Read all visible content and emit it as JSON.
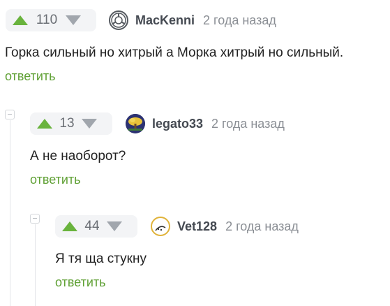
{
  "comments": [
    {
      "rating": "110",
      "author": "MacKenni",
      "time": "2 года назад",
      "text": "Горка сильный но хитрый а Морка хитрый но сильный.",
      "reply_label": "ответить",
      "avatar_icon": "scp-logo-icon"
    },
    {
      "rating": "13",
      "author": "legato33",
      "time": "2 года назад",
      "text": "А не наоборот?",
      "reply_label": "ответить",
      "avatar_icon": "tree-avatar-icon"
    },
    {
      "rating": "44",
      "author": "Vet128",
      "time": "2 года назад",
      "text": "Я тя ща стукну",
      "reply_label": "ответить",
      "avatar_icon": "face-avatar-icon"
    }
  ],
  "colors": {
    "upvote": "#69b33d",
    "downvote": "#a1a6ad",
    "reply_link": "#5fa034",
    "vote_bg": "#f3f4f6"
  }
}
